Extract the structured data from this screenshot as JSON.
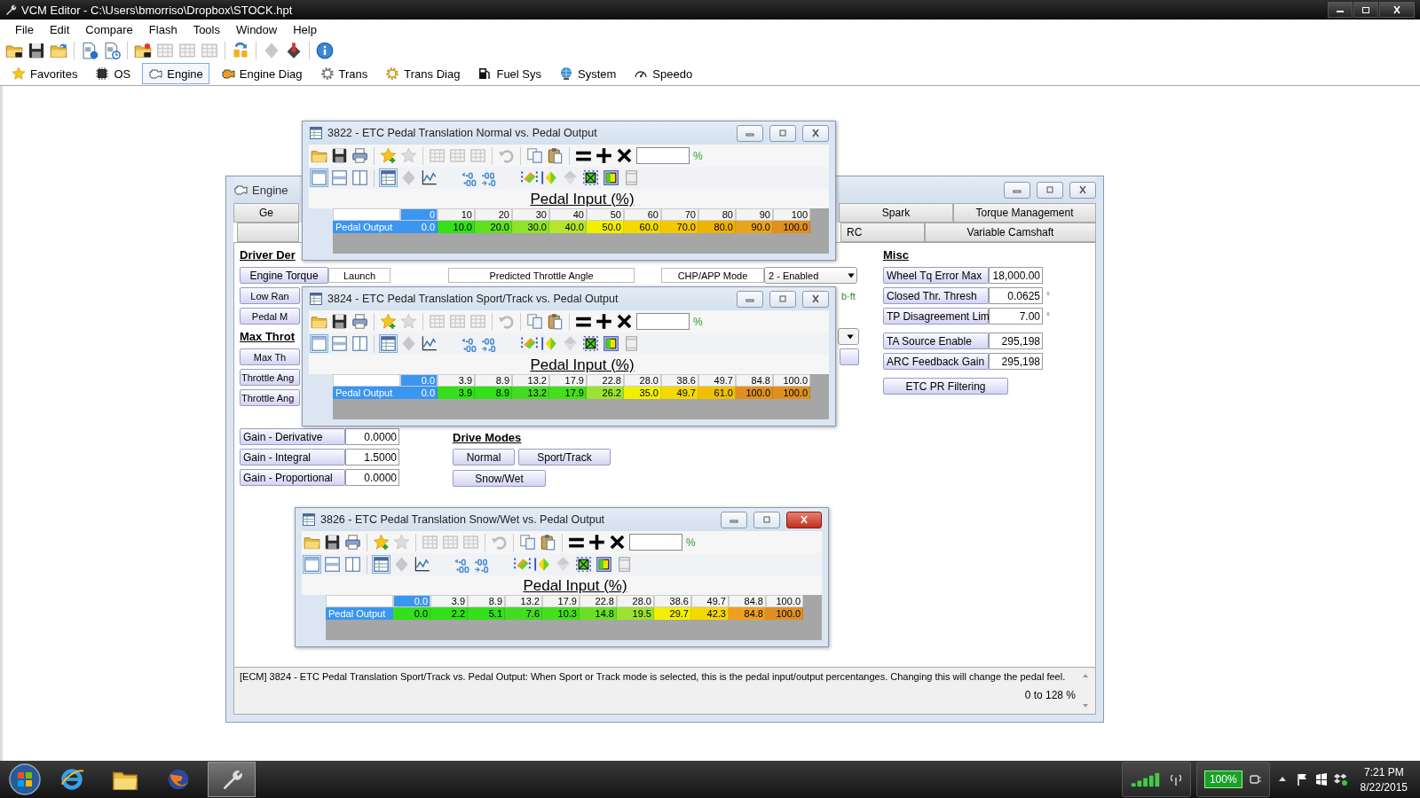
{
  "app": {
    "title": "VCM Editor - C:\\Users\\bmorriso\\Dropbox\\STOCK.hpt"
  },
  "menu": [
    "File",
    "Edit",
    "Compare",
    "Flash",
    "Tools",
    "Window",
    "Help"
  ],
  "categories": [
    {
      "label": "Favorites",
      "selected": false
    },
    {
      "label": "OS",
      "selected": false
    },
    {
      "label": "Engine",
      "selected": true
    },
    {
      "label": "Engine Diag",
      "selected": false
    },
    {
      "label": "Trans",
      "selected": false
    },
    {
      "label": "Trans Diag",
      "selected": false
    },
    {
      "label": "Fuel Sys",
      "selected": false
    },
    {
      "label": "System",
      "selected": false
    },
    {
      "label": "Speedo",
      "selected": false
    }
  ],
  "engine_window": {
    "title": "Engine",
    "tabs_row_1": [
      {
        "label": "Ge"
      },
      {
        "label": "Spark"
      },
      {
        "label": "Torque Management"
      }
    ],
    "tabs_row_2": [
      {
        "label": "RC"
      },
      {
        "label": "Variable Camshaft"
      }
    ],
    "driver_heading": "Driver Der",
    "torque_row": {
      "button": "Engine Torque",
      "cells": [
        "Launch",
        "Predicted Throttle Angle",
        "CHP/APP Mode"
      ],
      "dropdown": "2 - Enabled"
    },
    "driver_buttons": [
      "Low Ran",
      "Pedal M"
    ],
    "unit_fragment": "b·ft",
    "max_heading": "Max Throt",
    "max_buttons": [
      "Max Th",
      "Throttle Ang",
      "Throttle Ang"
    ],
    "gains": [
      {
        "label": "Gain - Derivative",
        "value": "0.0000"
      },
      {
        "label": "Gain - Integral",
        "value": "1.5000"
      },
      {
        "label": "Gain - Proportional",
        "value": "0.0000"
      }
    ],
    "drive_modes": {
      "heading": "Drive Modes",
      "buttons": [
        "Normal",
        "Sport/Track",
        "Snow/Wet"
      ]
    },
    "misc": {
      "heading": "Misc",
      "rows": [
        {
          "label": "Wheel Tq Error Max",
          "value": "18,000.00"
        },
        {
          "label": "Closed Thr. Thresh",
          "value": "0.0625",
          "unit": "°"
        },
        {
          "label": "TP Disagreement Lim",
          "value": "7.00",
          "unit": "°"
        },
        {
          "label": "TA Source Enable",
          "value": "295,198"
        },
        {
          "label": "ARC Feedback Gain",
          "value": "295,198"
        }
      ],
      "button": "ETC PR Filtering"
    },
    "description": "[ECM] 3824 - ETC Pedal Translation Sport/Track vs. Pedal Output: When Sport or Track mode is selected, this is the pedal input/output percentanges.  Changing this will change the pedal feel.",
    "range": "0 to 128 %"
  },
  "tables": [
    {
      "title": "3822 - ETC Pedal Translation Normal vs. Pedal Output",
      "active": false,
      "unit": "%",
      "axis_title": "Pedal Input (%)",
      "row_label": "Pedal Output",
      "columns": [
        {
          "label": "0",
          "selected": true
        },
        {
          "label": "10",
          "selected": false
        },
        {
          "label": "20",
          "selected": false
        },
        {
          "label": "30",
          "selected": false
        },
        {
          "label": "40",
          "selected": false
        },
        {
          "label": "50",
          "selected": false
        },
        {
          "label": "60",
          "selected": false
        },
        {
          "label": "70",
          "selected": false
        },
        {
          "label": "80",
          "selected": false
        },
        {
          "label": "90",
          "selected": false
        },
        {
          "label": "100",
          "selected": false
        }
      ],
      "cells": [
        {
          "value": "0.0",
          "selected": true
        },
        {
          "value": "10.0",
          "selected": false,
          "color": "#33e01a"
        },
        {
          "value": "20.0",
          "selected": false,
          "color": "#5ee020"
        },
        {
          "value": "30.0",
          "selected": false,
          "color": "#8ee428"
        },
        {
          "value": "40.0",
          "selected": false,
          "color": "#b4e62a"
        },
        {
          "value": "50.0",
          "selected": false,
          "color": "#f2f000"
        },
        {
          "value": "60.0",
          "selected": false,
          "color": "#f5d800"
        },
        {
          "value": "70.0",
          "selected": false,
          "color": "#f3c800"
        },
        {
          "value": "80.0",
          "selected": false,
          "color": "#ecb400"
        },
        {
          "value": "90.0",
          "selected": false,
          "color": "#e8a41c"
        },
        {
          "value": "100.0",
          "selected": false,
          "color": "#e09020"
        }
      ]
    },
    {
      "title": "3824 - ETC Pedal Translation Sport/Track vs. Pedal Output",
      "active": false,
      "unit": "%",
      "axis_title": "Pedal Input (%)",
      "row_label": "Pedal Output",
      "columns": [
        {
          "label": "0.0",
          "selected": true
        },
        {
          "label": "3.9",
          "selected": false
        },
        {
          "label": "8.9",
          "selected": false
        },
        {
          "label": "13.2",
          "selected": false
        },
        {
          "label": "17.9",
          "selected": false
        },
        {
          "label": "22.8",
          "selected": false
        },
        {
          "label": "28.0",
          "selected": false
        },
        {
          "label": "38.6",
          "selected": false
        },
        {
          "label": "49.7",
          "selected": false
        },
        {
          "label": "84.8",
          "selected": false
        },
        {
          "label": "100.0",
          "selected": false
        }
      ],
      "cells": [
        {
          "value": "0.0",
          "selected": true
        },
        {
          "value": "3.9",
          "selected": false,
          "color": "#33e01a"
        },
        {
          "value": "8.9",
          "selected": false,
          "color": "#33e01a"
        },
        {
          "value": "13.2",
          "selected": false,
          "color": "#44dc22"
        },
        {
          "value": "17.9",
          "selected": false,
          "color": "#44e01a"
        },
        {
          "value": "26.2",
          "selected": false,
          "color": "#9ce230"
        },
        {
          "value": "35.0",
          "selected": false,
          "color": "#f2f000"
        },
        {
          "value": "49.7",
          "selected": false,
          "color": "#f5d800"
        },
        {
          "value": "61.0",
          "selected": false,
          "color": "#f0c000"
        },
        {
          "value": "100.0",
          "selected": false,
          "color": "#e09020"
        },
        {
          "value": "100.0",
          "selected": false,
          "color": "#e09020"
        }
      ]
    },
    {
      "title": "3826 - ETC Pedal Translation Snow/Wet vs. Pedal Output",
      "active": true,
      "unit": "%",
      "axis_title": "Pedal Input (%)",
      "row_label": "Pedal Output",
      "columns": [
        {
          "label": "0.0",
          "selected": true
        },
        {
          "label": "3.9",
          "selected": false
        },
        {
          "label": "8.9",
          "selected": false
        },
        {
          "label": "13.2",
          "selected": false
        },
        {
          "label": "17.9",
          "selected": false
        },
        {
          "label": "22.8",
          "selected": false
        },
        {
          "label": "28.0",
          "selected": false
        },
        {
          "label": "38.6",
          "selected": false
        },
        {
          "label": "49.7",
          "selected": false
        },
        {
          "label": "84.8",
          "selected": false
        },
        {
          "label": "100.0",
          "selected": false
        }
      ],
      "cells": [
        {
          "value": "0.0",
          "selected": false,
          "color": "#33e01a"
        },
        {
          "value": "2.2",
          "selected": false,
          "color": "#33e01a"
        },
        {
          "value": "5.1",
          "selected": false,
          "color": "#33e01a"
        },
        {
          "value": "7.6",
          "selected": false,
          "color": "#44dc22"
        },
        {
          "value": "10.3",
          "selected": false,
          "color": "#44e01a"
        },
        {
          "value": "14.8",
          "selected": false,
          "color": "#6ae024"
        },
        {
          "value": "19.5",
          "selected": false,
          "color": "#9ce230"
        },
        {
          "value": "29.7",
          "selected": false,
          "color": "#f2f000"
        },
        {
          "value": "42.3",
          "selected": false,
          "color": "#f5d800"
        },
        {
          "value": "84.8",
          "selected": false,
          "color": "#f0a020"
        },
        {
          "value": "100.0",
          "selected": false,
          "color": "#e09020"
        }
      ]
    }
  ],
  "taskbar": {
    "apps": [
      {
        "selected": false
      },
      {
        "selected": false
      },
      {
        "selected": false
      },
      {
        "selected": true
      }
    ],
    "battery": "100%",
    "time": "7:21 PM",
    "date": "8/22/2015"
  }
}
